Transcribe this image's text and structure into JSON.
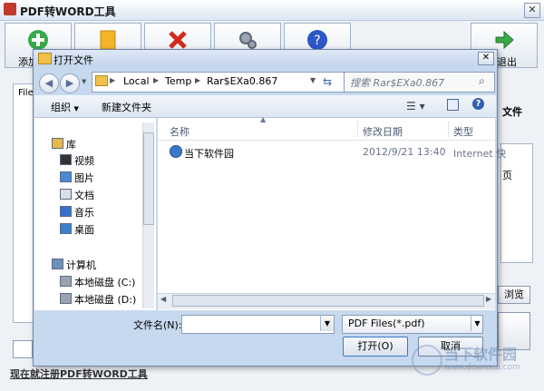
{
  "app": {
    "title": "PDF转WORD工具",
    "toolbar": [
      {
        "label": "添加",
        "icon": "add-icon"
      },
      {
        "label": "",
        "icon": "folder-icon"
      },
      {
        "label": "",
        "icon": "delete-icon"
      },
      {
        "label": "",
        "icon": "settings-icon"
      },
      {
        "label": "",
        "icon": "help-icon"
      },
      {
        "label": "退出",
        "icon": "exit-arrow-icon"
      }
    ],
    "left_header": "File",
    "right_fragments": [
      "文件",
      "页"
    ],
    "browse_label": "浏览",
    "register_link": "现在就注册PDF转WORD工具",
    "colors": {
      "accent": "#2f7fd1",
      "title_bg": "#dbe6f3"
    }
  },
  "dialog": {
    "title": "打开文件",
    "breadcrumbs": [
      "Local",
      "Temp",
      "Rar$EXa0.867"
    ],
    "search_placeholder": "搜索 Rar$EXa0.867",
    "commands": {
      "organize": "组织",
      "new_folder": "新建文件夹"
    },
    "nav_items": [
      {
        "label": "库",
        "icon": "library-icon",
        "indent": false
      },
      {
        "label": "视频",
        "icon": "video-icon",
        "indent": true
      },
      {
        "label": "图片",
        "icon": "pictures-icon",
        "indent": true
      },
      {
        "label": "文档",
        "icon": "documents-icon",
        "indent": true
      },
      {
        "label": "音乐",
        "icon": "music-icon",
        "indent": true
      },
      {
        "label": "桌面",
        "icon": "desktop-icon",
        "indent": true
      },
      {
        "label": "计算机",
        "icon": "computer-icon",
        "indent": false
      },
      {
        "label": "本地磁盘 (C:)",
        "icon": "drive-c-icon",
        "indent": true
      },
      {
        "label": "本地磁盘 (D:)",
        "icon": "drive-d-icon",
        "indent": true
      }
    ],
    "columns": [
      "名称",
      "修改日期",
      "类型"
    ],
    "files": [
      {
        "name": "当下软件园",
        "date": "2012/9/21 13:40",
        "type": "Internet 快"
      }
    ],
    "filename_label": "文件名(N):",
    "filename_value": "",
    "filetype_value": "PDF Files(*.pdf)",
    "open_label": "打开(O)",
    "cancel_label": "取消"
  },
  "watermark": {
    "text": "当下软件园",
    "url": "www.downxia.com"
  }
}
